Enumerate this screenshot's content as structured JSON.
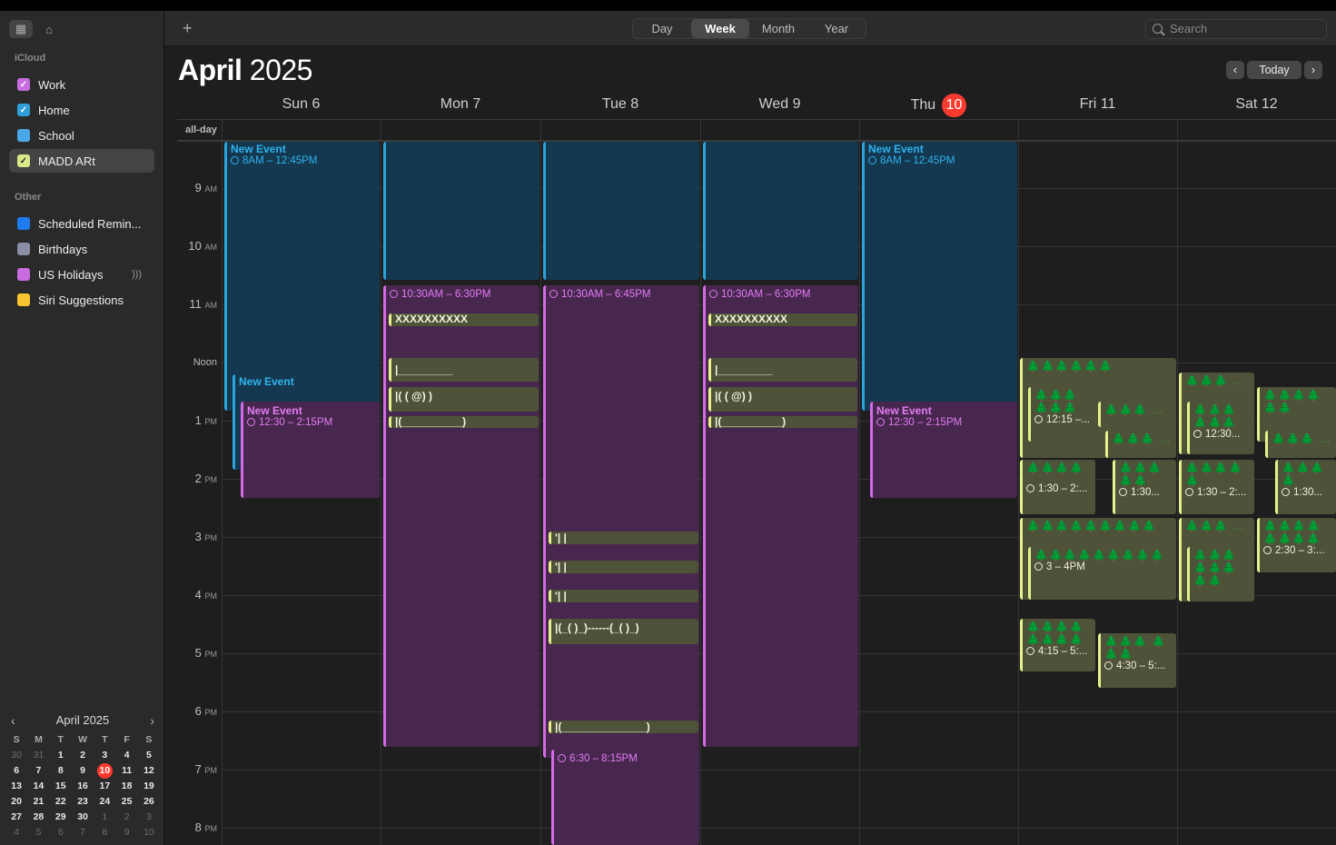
{
  "toolbar": {
    "views": [
      "Day",
      "Week",
      "Month",
      "Year"
    ],
    "active_view": "Week",
    "search_placeholder": "Search",
    "add_icon": "plus-icon"
  },
  "header": {
    "month": "April",
    "year": "2025",
    "today_label": "Today"
  },
  "sidebar": {
    "icloud_label": "iCloud",
    "other_label": "Other",
    "calendars": [
      {
        "label": "Work",
        "color": "#c86ce0",
        "checked": true
      },
      {
        "label": "Home",
        "color": "#2e9fd8",
        "checked": true
      },
      {
        "label": "School",
        "color": "#4aa8e8",
        "checked": false
      },
      {
        "label": "MADD ARt",
        "color": "#d8e88a",
        "checked": true
      }
    ],
    "other": [
      {
        "label": "Scheduled Remin...",
        "color": "#1e7cf0"
      },
      {
        "label": "Birthdays",
        "color": "#8b8fa6"
      },
      {
        "label": "US Holidays",
        "color": "#c86ce0"
      },
      {
        "label": "Siri Suggestions",
        "color": "#f6c530"
      }
    ]
  },
  "mini_calendar": {
    "title": "April 2025",
    "dow": [
      "S",
      "M",
      "T",
      "W",
      "T",
      "F",
      "S"
    ],
    "days": [
      "30",
      "31",
      "1",
      "2",
      "3",
      "4",
      "5",
      "6",
      "7",
      "8",
      "9",
      "10",
      "11",
      "12",
      "13",
      "14",
      "15",
      "16",
      "17",
      "18",
      "19",
      "20",
      "21",
      "22",
      "23",
      "24",
      "25",
      "26",
      "27",
      "28",
      "29",
      "30",
      "1",
      "2",
      "3",
      "4",
      "5",
      "6",
      "7",
      "8",
      "9",
      "10"
    ],
    "today": "10"
  },
  "days": [
    {
      "label": "Sun 6"
    },
    {
      "label": "Mon 7"
    },
    {
      "label": "Tue 8"
    },
    {
      "label": "Wed 9"
    },
    {
      "label": "Thu",
      "badge": "10"
    },
    {
      "label": "Fri 11"
    },
    {
      "label": "Sat 12"
    }
  ],
  "allday_label": "all-day",
  "hours": [
    {
      "h": "9",
      "ap": "AM"
    },
    {
      "h": "10",
      "ap": "AM"
    },
    {
      "h": "11",
      "ap": "AM"
    },
    {
      "h": "Noon",
      "ap": ""
    },
    {
      "h": "1",
      "ap": "PM"
    },
    {
      "h": "2",
      "ap": "PM"
    },
    {
      "h": "3",
      "ap": "PM"
    },
    {
      "h": "4",
      "ap": "PM"
    },
    {
      "h": "5",
      "ap": "PM"
    },
    {
      "h": "6",
      "ap": "PM"
    },
    {
      "h": "7",
      "ap": "PM"
    },
    {
      "h": "8",
      "ap": "PM"
    }
  ],
  "events": {
    "new_event": "New Event",
    "t_8_1245": "8AM – 12:45PM",
    "t_1230_215": "12:30 – 2:15PM",
    "t_1030_630": "10:30AM – 6:30PM",
    "t_1030_645": "10:30AM – 6:45PM",
    "t_630_815": "6:30 – 8:15PM",
    "art_x": "XXXXXXXXXX",
    "art_line": "|_________",
    "art_eyes": "|(    (    @)    )",
    "art_mouth": "|(__________)",
    "art_tick": "'|                            |",
    "art_feet": "|(_(    )_)------(_(    )_)",
    "art_base": "|(______________)",
    "trees5": "🌲🌲🌲🌲🌲🌲",
    "fri": {
      "a_time": "12:15 –...",
      "b_time": "1:30 – 2:...",
      "c_time": "1:30...",
      "d_time": "3 – 4PM",
      "e_time": "4:15 – 5:...",
      "f_time": "4:30 – 5:..."
    },
    "sat": {
      "a_time": "12:30...",
      "b_time": "1:30 – 2:...",
      "c_time": "1:30...",
      "d_time": "2:30 – 3:..."
    }
  }
}
